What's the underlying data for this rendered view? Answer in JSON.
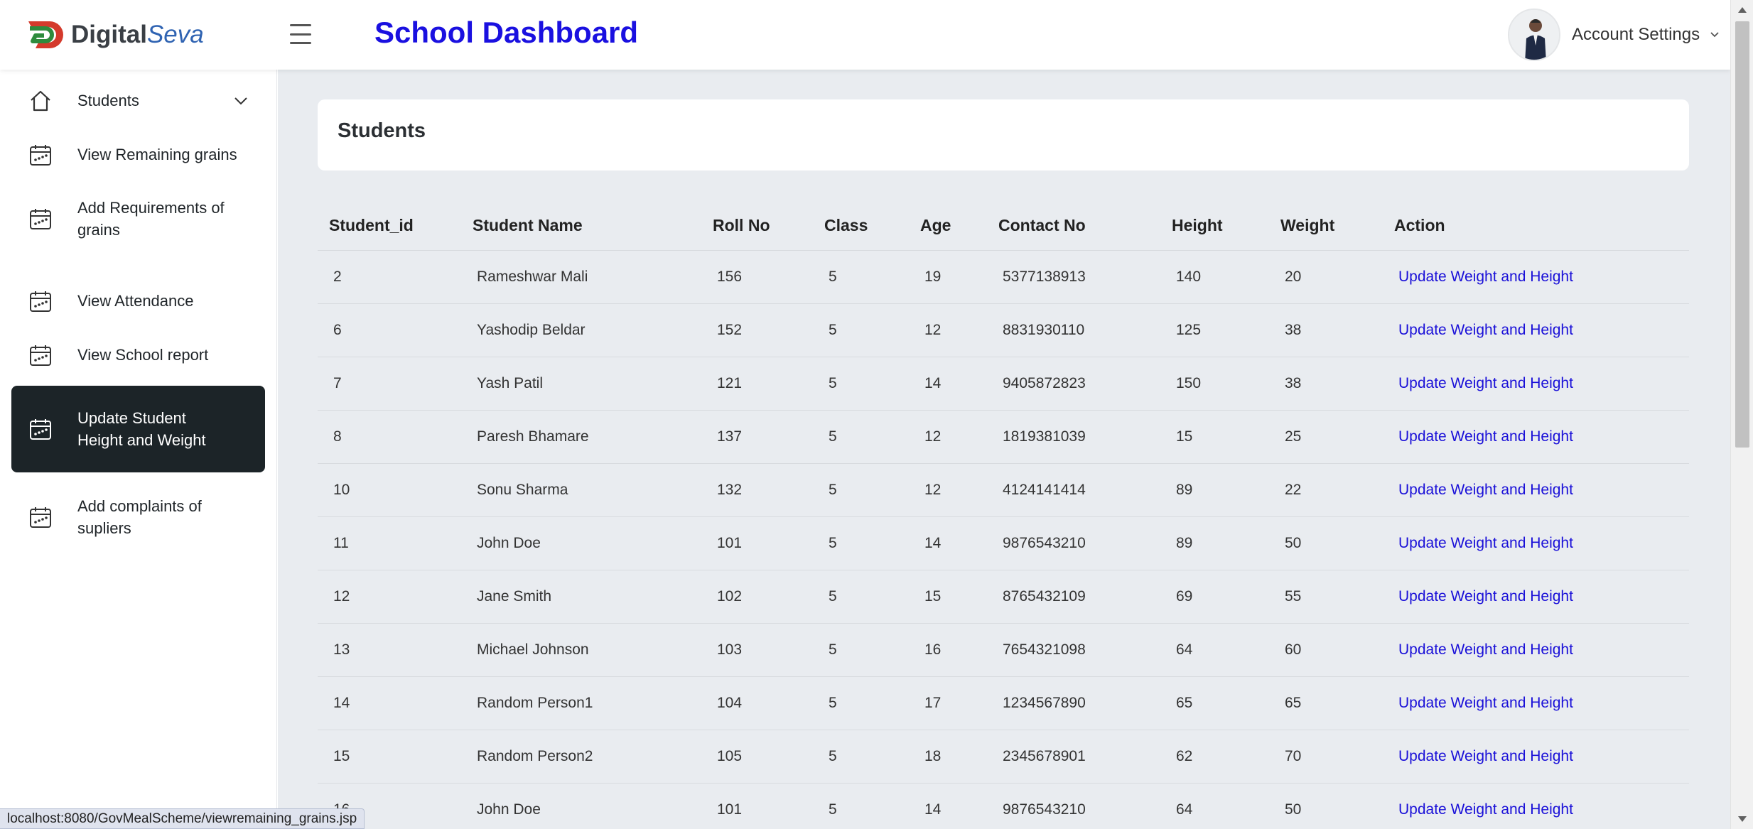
{
  "brand": {
    "name_primary": "Digital",
    "name_secondary": "Seva"
  },
  "header": {
    "title": "School Dashboard",
    "account_label": "Account Settings"
  },
  "sidebar": {
    "items": [
      {
        "label": "Students",
        "icon": "home-icon"
      },
      {
        "label": "View Remaining grains",
        "icon": "calendar-icon"
      },
      {
        "label": "Add Requirements of grains",
        "icon": "calendar-icon"
      },
      {
        "label": "View Attendance",
        "icon": "calendar-icon"
      },
      {
        "label": "View School report",
        "icon": "calendar-icon"
      },
      {
        "label": "Update Student Height and Weight",
        "icon": "calendar-icon",
        "active": true
      },
      {
        "label": "Add complaints of supliers",
        "icon": "calendar-icon"
      }
    ]
  },
  "main": {
    "card_title": "Students",
    "table": {
      "headers": [
        "Student_id",
        "Student Name",
        "Roll No",
        "Class",
        "Age",
        "Contact No",
        "Height",
        "Weight",
        "Action"
      ],
      "rows": [
        [
          "2",
          "Rameshwar Mali",
          "156",
          "5",
          "19",
          "5377138913",
          "140",
          "20",
          "Update Weight and Height"
        ],
        [
          "6",
          "Yashodip Beldar",
          "152",
          "5",
          "12",
          "8831930110",
          "125",
          "38",
          "Update Weight and Height"
        ],
        [
          "7",
          "Yash Patil",
          "121",
          "5",
          "14",
          "9405872823",
          "150",
          "38",
          "Update Weight and Height"
        ],
        [
          "8",
          "Paresh Bhamare",
          "137",
          "5",
          "12",
          "1819381039",
          "15",
          "25",
          "Update Weight and Height"
        ],
        [
          "10",
          "Sonu Sharma",
          "132",
          "5",
          "12",
          "4124141414",
          "89",
          "22",
          "Update Weight and Height"
        ],
        [
          "11",
          "John Doe",
          "101",
          "5",
          "14",
          "9876543210",
          "89",
          "50",
          "Update Weight and Height"
        ],
        [
          "12",
          "Jane Smith",
          "102",
          "5",
          "15",
          "8765432109",
          "69",
          "55",
          "Update Weight and Height"
        ],
        [
          "13",
          "Michael Johnson",
          "103",
          "5",
          "16",
          "7654321098",
          "64",
          "60",
          "Update Weight and Height"
        ],
        [
          "14",
          "Random Person1",
          "104",
          "5",
          "17",
          "1234567890",
          "65",
          "65",
          "Update Weight and Height"
        ],
        [
          "15",
          "Random Person2",
          "105",
          "5",
          "18",
          "2345678901",
          "62",
          "70",
          "Update Weight and Height"
        ],
        [
          "16",
          "John Doe",
          "101",
          "5",
          "14",
          "9876543210",
          "64",
          "50",
          "Update Weight and Height"
        ]
      ]
    }
  },
  "status_bar": {
    "url": "localhost:8080/GovMealScheme/viewremaining_grains.jsp"
  },
  "colors": {
    "title": "#1a10e0",
    "link": "#1a10d8",
    "active_nav": "#1c2428",
    "main_bg": "#e9ecf0"
  }
}
